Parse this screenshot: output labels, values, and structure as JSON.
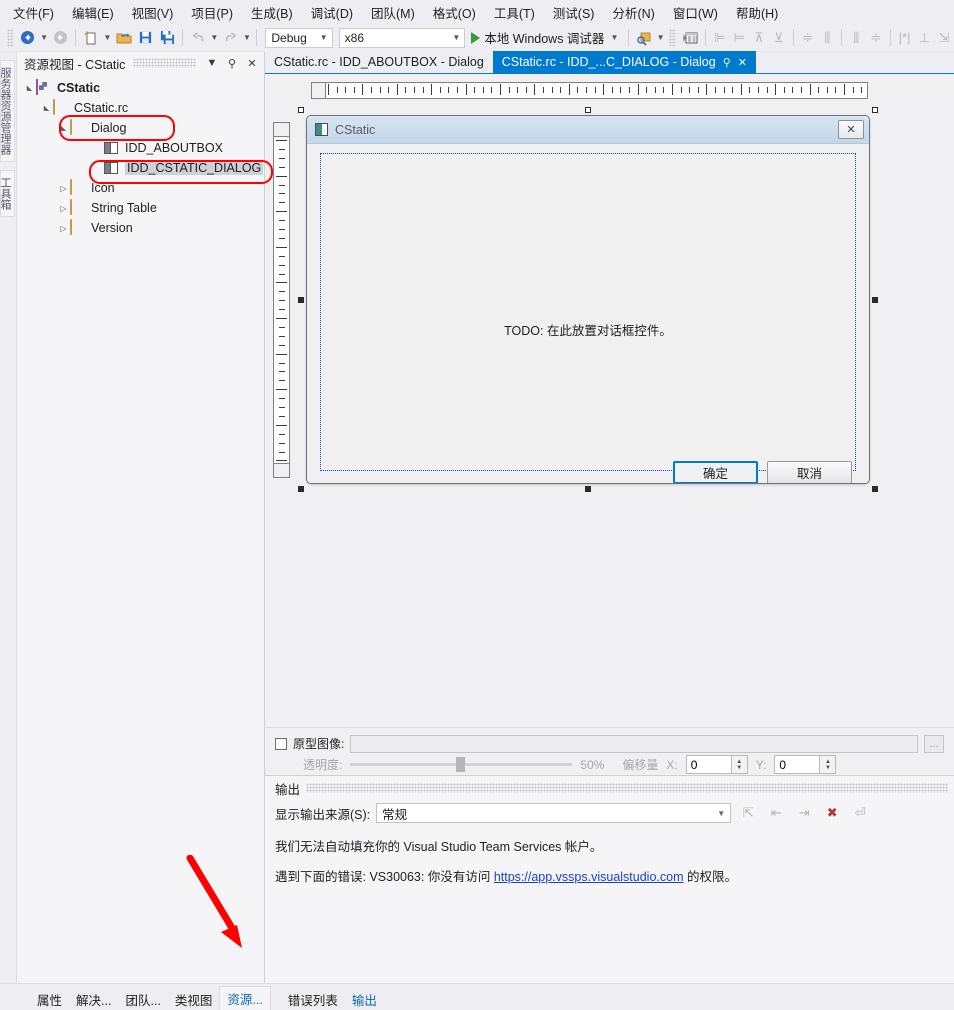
{
  "menubar": {
    "items": [
      {
        "label": "文件(F)"
      },
      {
        "label": "编辑(E)"
      },
      {
        "label": "视图(V)"
      },
      {
        "label": "项目(P)"
      },
      {
        "label": "生成(B)"
      },
      {
        "label": "调试(D)"
      },
      {
        "label": "团队(M)"
      },
      {
        "label": "格式(O)"
      },
      {
        "label": "工具(T)"
      },
      {
        "label": "测试(S)"
      },
      {
        "label": "分析(N)"
      },
      {
        "label": "窗口(W)"
      },
      {
        "label": "帮助(H)"
      }
    ]
  },
  "toolbar": {
    "configuration": "Debug",
    "platform": "x86",
    "run_label": "本地 Windows 调试器",
    "icons": [
      "navigate-back-icon",
      "navigate-forward-icon",
      "new-item-icon",
      "open-file-icon",
      "save-icon",
      "save-all-icon",
      "undo-icon",
      "redo-icon"
    ],
    "format_icons": [
      "find-icon",
      "properties-window-icon",
      "align-lefts-icon",
      "align-rights-icon",
      "align-tops-icon",
      "align-bottoms-icon",
      "center-vertical-icon",
      "space-across-icon",
      "space-down-icon",
      "center-horizontal-icon",
      "make-same-width-icon",
      "make-same-height-icon",
      "size-to-content-icon"
    ]
  },
  "dockstrip": {
    "tabs": [
      {
        "label": "服务器资源管理器"
      },
      {
        "label": "工具箱"
      }
    ]
  },
  "resource_view": {
    "title": "资源视图 - CStatic",
    "header_icons": [
      "chevron-down-icon",
      "pin-icon",
      "close-icon"
    ],
    "tree": [
      {
        "label": "CStatic",
        "indent": 0,
        "twisty": "▲",
        "icon": "project-icon",
        "bold": true,
        "selected": false
      },
      {
        "label": "CStatic.rc",
        "indent": 1,
        "twisty": "▲",
        "icon": "folder-open-icon",
        "bold": false,
        "selected": false
      },
      {
        "label": "Dialog",
        "indent": 2,
        "twisty": "▲",
        "icon": "folder-open-icon",
        "bold": false,
        "selected": false
      },
      {
        "label": "IDD_ABOUTBOX",
        "indent": 4,
        "twisty": "",
        "icon": "dialog-resource-icon",
        "bold": false,
        "selected": false
      },
      {
        "label": "IDD_CSTATIC_DIALOG",
        "indent": 4,
        "twisty": "",
        "icon": "dialog-resource-icon",
        "bold": false,
        "selected": true
      },
      {
        "label": "Icon",
        "indent": 2,
        "twisty": "▷",
        "icon": "folder-icon",
        "bold": false,
        "selected": false
      },
      {
        "label": "String Table",
        "indent": 2,
        "twisty": "▷",
        "icon": "folder-icon",
        "bold": false,
        "selected": false
      },
      {
        "label": "Version",
        "indent": 2,
        "twisty": "▷",
        "icon": "folder-icon",
        "bold": false,
        "selected": false
      }
    ]
  },
  "editor_tabs": [
    {
      "label": "CStatic.rc - IDD_ABOUTBOX - Dialog",
      "active": false
    },
    {
      "label": "CStatic.rc - IDD_...C_DIALOG - Dialog",
      "active": true
    }
  ],
  "designer": {
    "dialog": {
      "title": "CStatic",
      "app_icon": "app-icon",
      "close_icon": "close-box-icon",
      "body_text": "TODO: 在此放置对话框控件。",
      "buttons": [
        {
          "label": "确定",
          "primary": true
        },
        {
          "label": "取消",
          "primary": false
        }
      ]
    }
  },
  "prototype_bar": {
    "checkbox_label": "原型图像:",
    "path_value": "",
    "browse_label": "...",
    "transparency_label": "透明度:",
    "transparency_value": "50%",
    "offset_label": "偏移量",
    "x_label": "X:",
    "x_value": "0",
    "y_label": "Y:",
    "y_value": "0"
  },
  "output": {
    "title": "输出",
    "source_label": "显示输出来源(S):",
    "source_value": "常规",
    "toolbar_icons": [
      "find-message-source-icon",
      "go-to-previous-icon",
      "go-to-next-icon",
      "clear-all-icon",
      "toggle-word-wrap-icon"
    ],
    "lines": [
      {
        "text": "我们无法自动填充你的 Visual Studio Team Services 帐户。",
        "link": null
      },
      {
        "text": "遇到下面的错误: VS30063: 你没有访问 ",
        "link": "https://app.vssps.visualstudio.com",
        "suffix": " 的权限。"
      }
    ]
  },
  "bottom_tabs": {
    "left_group": [
      {
        "label": "属性",
        "state": "normal"
      },
      {
        "label": "解决...",
        "state": "normal"
      },
      {
        "label": "团队...",
        "state": "normal"
      },
      {
        "label": "类视图",
        "state": "normal"
      },
      {
        "label": "资源...",
        "state": "selected"
      }
    ],
    "right_group": [
      {
        "label": "错误列表",
        "state": "normal"
      },
      {
        "label": "输出",
        "state": "blue"
      }
    ]
  },
  "annotations": {
    "color": "#ff0000",
    "highlight_targets": [
      "Dialog",
      "IDD_CSTATIC_DIALOG"
    ],
    "arrow_target": "资源..."
  }
}
